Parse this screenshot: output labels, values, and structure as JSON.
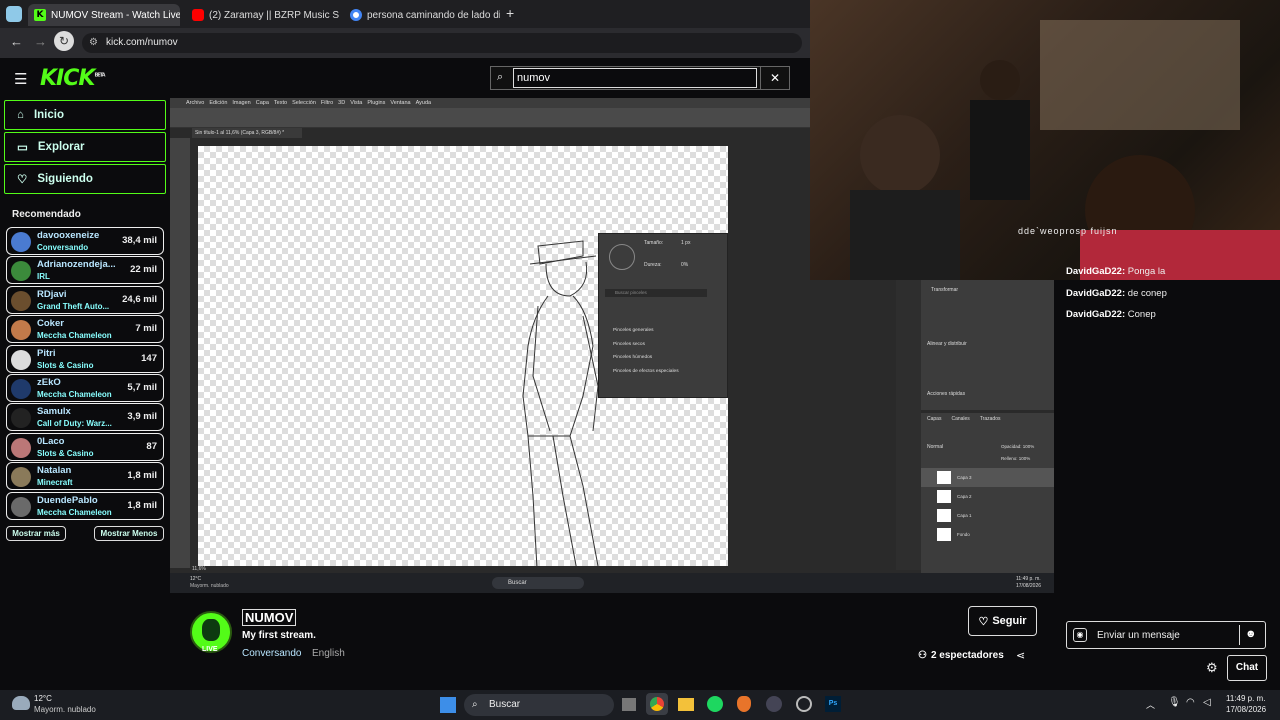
{
  "browser": {
    "tabs": [
      {
        "label": "NUMOV Stream - Watch Live o",
        "favicon": "kick"
      },
      {
        "label": "(2) Zaramay || BZRP Music S",
        "favicon": "youtube"
      },
      {
        "label": "persona caminando de lado di",
        "favicon": "google"
      }
    ],
    "url": "kick.com/numov"
  },
  "kick": {
    "logo": "KICK",
    "logo_badge": "BETA",
    "search_value": "numov",
    "nav": [
      {
        "label": "Inicio",
        "icon": "home-icon"
      },
      {
        "label": "Explorar",
        "icon": "compass-icon"
      },
      {
        "label": "Siguiendo",
        "icon": "heart-icon"
      }
    ],
    "recommended_title": "Recomendado",
    "recommended": [
      {
        "name": "davooxeneize",
        "category": "Conversando",
        "viewers": "38,4 mil",
        "color": "#4a7bd1"
      },
      {
        "name": "Adrianozendeja...",
        "category": "IRL",
        "viewers": "22 mil",
        "color": "#3b8a3b"
      },
      {
        "name": "RDjavi",
        "category": "Grand Theft Auto...",
        "viewers": "24,6 mil",
        "color": "#6b4e2e"
      },
      {
        "name": "Coker",
        "category": "Meccha Chameleon",
        "viewers": "7 mil",
        "color": "#c27a4a"
      },
      {
        "name": "Pitri",
        "category": "Slots & Casino",
        "viewers": "147",
        "color": "#ddd"
      },
      {
        "name": "zEkO",
        "category": "Meccha Chameleon",
        "viewers": "5,7 mil",
        "color": "#1f3a6b"
      },
      {
        "name": "Samulx",
        "category": "Call of Duty: Warz...",
        "viewers": "3,9 mil",
        "color": "#222"
      },
      {
        "name": "0Laco",
        "category": "Slots & Casino",
        "viewers": "87",
        "color": "#b77"
      },
      {
        "name": "Natalan",
        "category": "Minecraft",
        "viewers": "1,8 mil",
        "color": "#8a7a5a"
      },
      {
        "name": "DuendePablo",
        "category": "Meccha Chameleon",
        "viewers": "1,8 mil",
        "color": "#6a6a6a"
      }
    ],
    "show_more": "Mostrar más",
    "show_less": "Mostrar Menos"
  },
  "photoshop": {
    "menu": [
      "Archivo",
      "Edición",
      "Imagen",
      "Capa",
      "Texto",
      "Selección",
      "Filtro",
      "3D",
      "Vista",
      "Plugins",
      "Ventana",
      "Ayuda"
    ],
    "doc_tab": "Sin título-1 al 11,6% (Capa 3, RGB/8#) *",
    "brush_panel": {
      "size_label": "Tamaño:",
      "size_value": "1 px",
      "hardness_label": "Dureza:",
      "hardness_value": "0%",
      "search_placeholder": "Buscar pinceles",
      "folders": [
        "Pinceles generales",
        "Pinceles secos",
        "Pinceles húmedos",
        "Pinceles de efectos especiales"
      ]
    },
    "properties": {
      "title": "Transformar",
      "align_title": "Alinear y distribuir",
      "quick_title": "Acciones rápidas"
    },
    "layers": {
      "tabs": [
        "Capas",
        "Canales",
        "Trazados"
      ],
      "blend": "Normal",
      "opacity_label": "Opacidad:",
      "opacity": "100%",
      "fill_label": "Relleno:",
      "fill": "100%",
      "items": [
        "Capa 3",
        "Capa 2",
        "Capa 1",
        "Fondo"
      ]
    },
    "status": "11,6%",
    "win_taskbar": {
      "weather_temp": "12°C",
      "weather_desc": "Mayorm. nublado",
      "search": "Buscar",
      "time": "11:49 p. m.",
      "date": "17/08/2026"
    }
  },
  "camera_overlay_text": "dde`weoprosp fuijsn",
  "chat": {
    "messages": [
      {
        "user": "DavidGaD22:",
        "text": "Ponga la"
      },
      {
        "user": "DavidGaD22:",
        "text": "de conep"
      },
      {
        "user": "DavidGaD22:",
        "text": "Conep"
      }
    ],
    "input_placeholder": "Enviar un mensaje",
    "send_label": "Chat"
  },
  "streamer": {
    "name": "NUMOV",
    "title": "My first stream.",
    "category": "Conversando",
    "language": "English",
    "live_badge": "LIVE",
    "follow": "Seguir",
    "viewers": "2 espectadores"
  },
  "taskbar": {
    "weather_temp": "12°C",
    "weather_desc": "Mayorm. nublado",
    "search": "Buscar",
    "time": "11:49 p. m.",
    "date": "17/08/2026"
  },
  "colors": {
    "kick_green": "#53fc18",
    "chat_accent": "#ffffff"
  }
}
